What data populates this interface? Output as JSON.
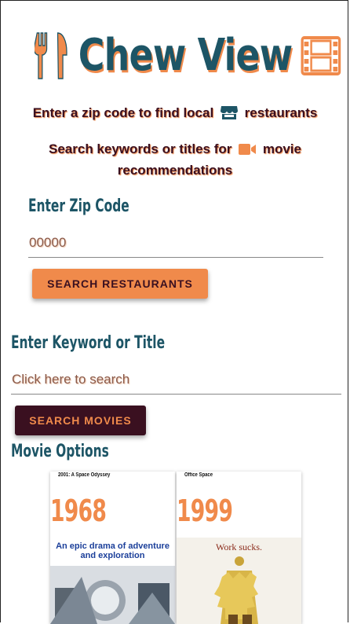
{
  "app": {
    "title": "Chew View",
    "tagline_restaurants_before": "Enter a zip code to find local",
    "tagline_restaurants_after": "restaurants",
    "tagline_movies_before": "Search keywords or titles for",
    "tagline_movies_after": "movie",
    "tagline_movies_line2": "recommendations"
  },
  "zip": {
    "label": "Enter Zip Code",
    "placeholder": "00000",
    "button": "SEARCH RESTAURANTS"
  },
  "keyword": {
    "label": "Enter Keyword or Title",
    "placeholder": "Click here to search",
    "button": "SEARCH MOVIES"
  },
  "movies": {
    "heading": "Movie Options",
    "items": [
      {
        "title": "2001: A Space Odyssey",
        "year": "1968",
        "poster_text": "An epic drama of adventure and exploration"
      },
      {
        "title": "Office Space",
        "year": "1999",
        "poster_text": "Work sucks."
      }
    ]
  },
  "colors": {
    "teal": "#1d5566",
    "orange": "#f08a4b",
    "maroon": "#3a1020"
  },
  "icons": [
    "utensils-icon",
    "film-icon",
    "store-icon",
    "video-camera-icon"
  ]
}
